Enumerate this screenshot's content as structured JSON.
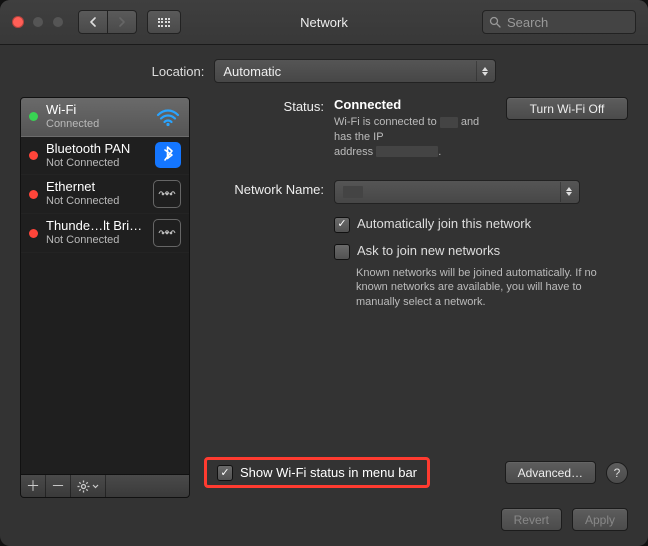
{
  "window": {
    "title": "Network",
    "searchPlaceholder": "Search"
  },
  "location": {
    "label": "Location:",
    "value": "Automatic"
  },
  "sidebar": {
    "items": [
      {
        "name": "Wi-Fi",
        "sub": "Connected",
        "status": "green",
        "icon": "wifi",
        "active": true
      },
      {
        "name": "Bluetooth PAN",
        "sub": "Not Connected",
        "status": "red",
        "icon": "bluetooth"
      },
      {
        "name": "Ethernet",
        "sub": "Not Connected",
        "status": "red",
        "icon": "ethernet"
      },
      {
        "name": "Thunde…lt Bridge",
        "sub": "Not Connected",
        "status": "red",
        "icon": "thunderbolt"
      }
    ]
  },
  "detail": {
    "statusLabel": "Status:",
    "statusValue": "Connected",
    "turnOff": "Turn Wi-Fi Off",
    "statusNote1a": "Wi-Fi is connected to ",
    "statusNote1b": " and has the IP",
    "statusNote2a": "address ",
    "statusNote2b": ".",
    "networkNameLabel": "Network Name:",
    "networkNameValue": "",
    "autoJoin": "Automatically join this network",
    "askJoin": "Ask to join new networks",
    "askNote": "Known networks will be joined automatically. If no known networks are available, you will have to manually select a network.",
    "showStatus": "Show Wi-Fi status in menu bar",
    "advanced": "Advanced…"
  },
  "buttons": {
    "revert": "Revert",
    "apply": "Apply",
    "help": "?"
  }
}
